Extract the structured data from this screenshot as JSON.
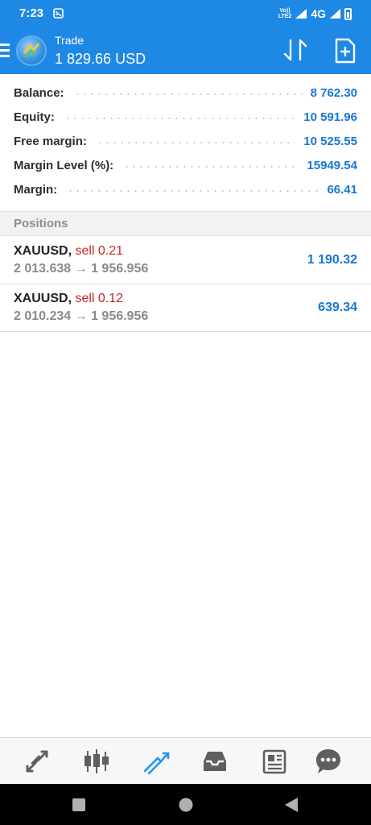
{
  "status_bar": {
    "time": "7:23",
    "network": "4G",
    "volte_top": "Vo))",
    "volte_bottom": "LTE2"
  },
  "app_bar": {
    "title": "Trade",
    "subtitle": "1 829.66 USD"
  },
  "account": [
    {
      "label": "Balance:",
      "value": "8 762.30"
    },
    {
      "label": "Equity:",
      "value": "10 591.96"
    },
    {
      "label": "Free margin:",
      "value": "10 525.55"
    },
    {
      "label": "Margin Level (%):",
      "value": "15949.54"
    },
    {
      "label": "Margin:",
      "value": "66.41"
    }
  ],
  "positions": {
    "header": "Positions",
    "items": [
      {
        "symbol": "XAUUSD,",
        "side": "sell 0.21",
        "prices": "2 013.638 → 1 956.956",
        "profit": "1 190.32"
      },
      {
        "symbol": "XAUUSD,",
        "side": "sell 0.12",
        "prices": "2 010.234 → 1 956.956",
        "profit": "639.34"
      }
    ]
  },
  "tabs": [
    {
      "icon": "quotes-arrows-icon",
      "active": false
    },
    {
      "icon": "candlestick-chart-icon",
      "active": false
    },
    {
      "icon": "trade-icon",
      "active": true
    },
    {
      "icon": "history-inbox-icon",
      "active": false
    },
    {
      "icon": "news-icon",
      "active": false
    },
    {
      "icon": "messages-chat-icon",
      "active": false
    }
  ],
  "colors": {
    "brand_blue": "#1e88e5",
    "value_blue": "#1976d2",
    "sell_red": "#c62828",
    "tab_inactive": "#5f5f5f",
    "tab_active": "#2196f3"
  }
}
